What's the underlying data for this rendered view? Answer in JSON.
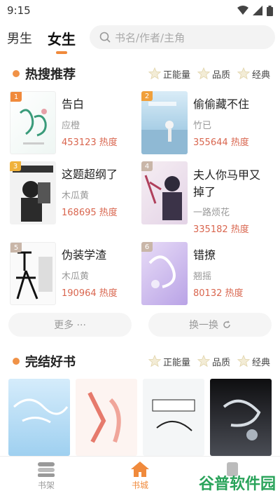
{
  "status": {
    "time": "9:15"
  },
  "tabs": {
    "male": "男生",
    "female": "女生"
  },
  "search": {
    "placeholder": "书名/作者/主角"
  },
  "hot": {
    "title": "热搜推荐",
    "filters": [
      "正能量",
      "品质",
      "经典"
    ],
    "books": [
      {
        "rank": "1",
        "title": "告白",
        "author": "应橙",
        "heat": "453123 热度"
      },
      {
        "rank": "2",
        "title": "偷偷藏不住",
        "author": "竹已",
        "heat": "355644 热度"
      },
      {
        "rank": "3",
        "title": "这题超纲了",
        "author": "木瓜黄",
        "heat": "168695 热度"
      },
      {
        "rank": "4",
        "title": "夫人你马甲又掉了",
        "author": "一路烦花",
        "heat": "335182 热度"
      },
      {
        "rank": "5",
        "title": "伪装学渣",
        "author": "木瓜黄",
        "heat": "190964 热度"
      },
      {
        "rank": "6",
        "title": "错撩",
        "author": "翘摇",
        "heat": "80132 热度"
      }
    ],
    "more_label": "更多 ···",
    "refresh_label": "换一换"
  },
  "finished": {
    "title": "完结好书",
    "filters": [
      "正能量",
      "品质",
      "经典"
    ]
  },
  "tabbar": {
    "shelf": "书架",
    "store": "书城"
  },
  "watermark": "谷普软件园",
  "colors": {
    "accent": "#f08a3c",
    "heat": "#d9664f"
  }
}
